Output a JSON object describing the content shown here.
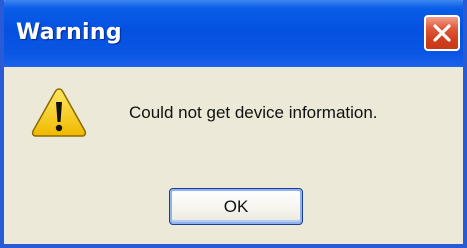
{
  "window": {
    "title": "Warning",
    "close_icon": "close-icon"
  },
  "dialog": {
    "icon": "warning-icon",
    "message": "Could not get device information.",
    "ok_label": "OK"
  },
  "colors": {
    "titlebar": "#0450e0",
    "body": "#ece9d8",
    "close_button": "#d0401e",
    "warning_icon": "#f4c400"
  }
}
